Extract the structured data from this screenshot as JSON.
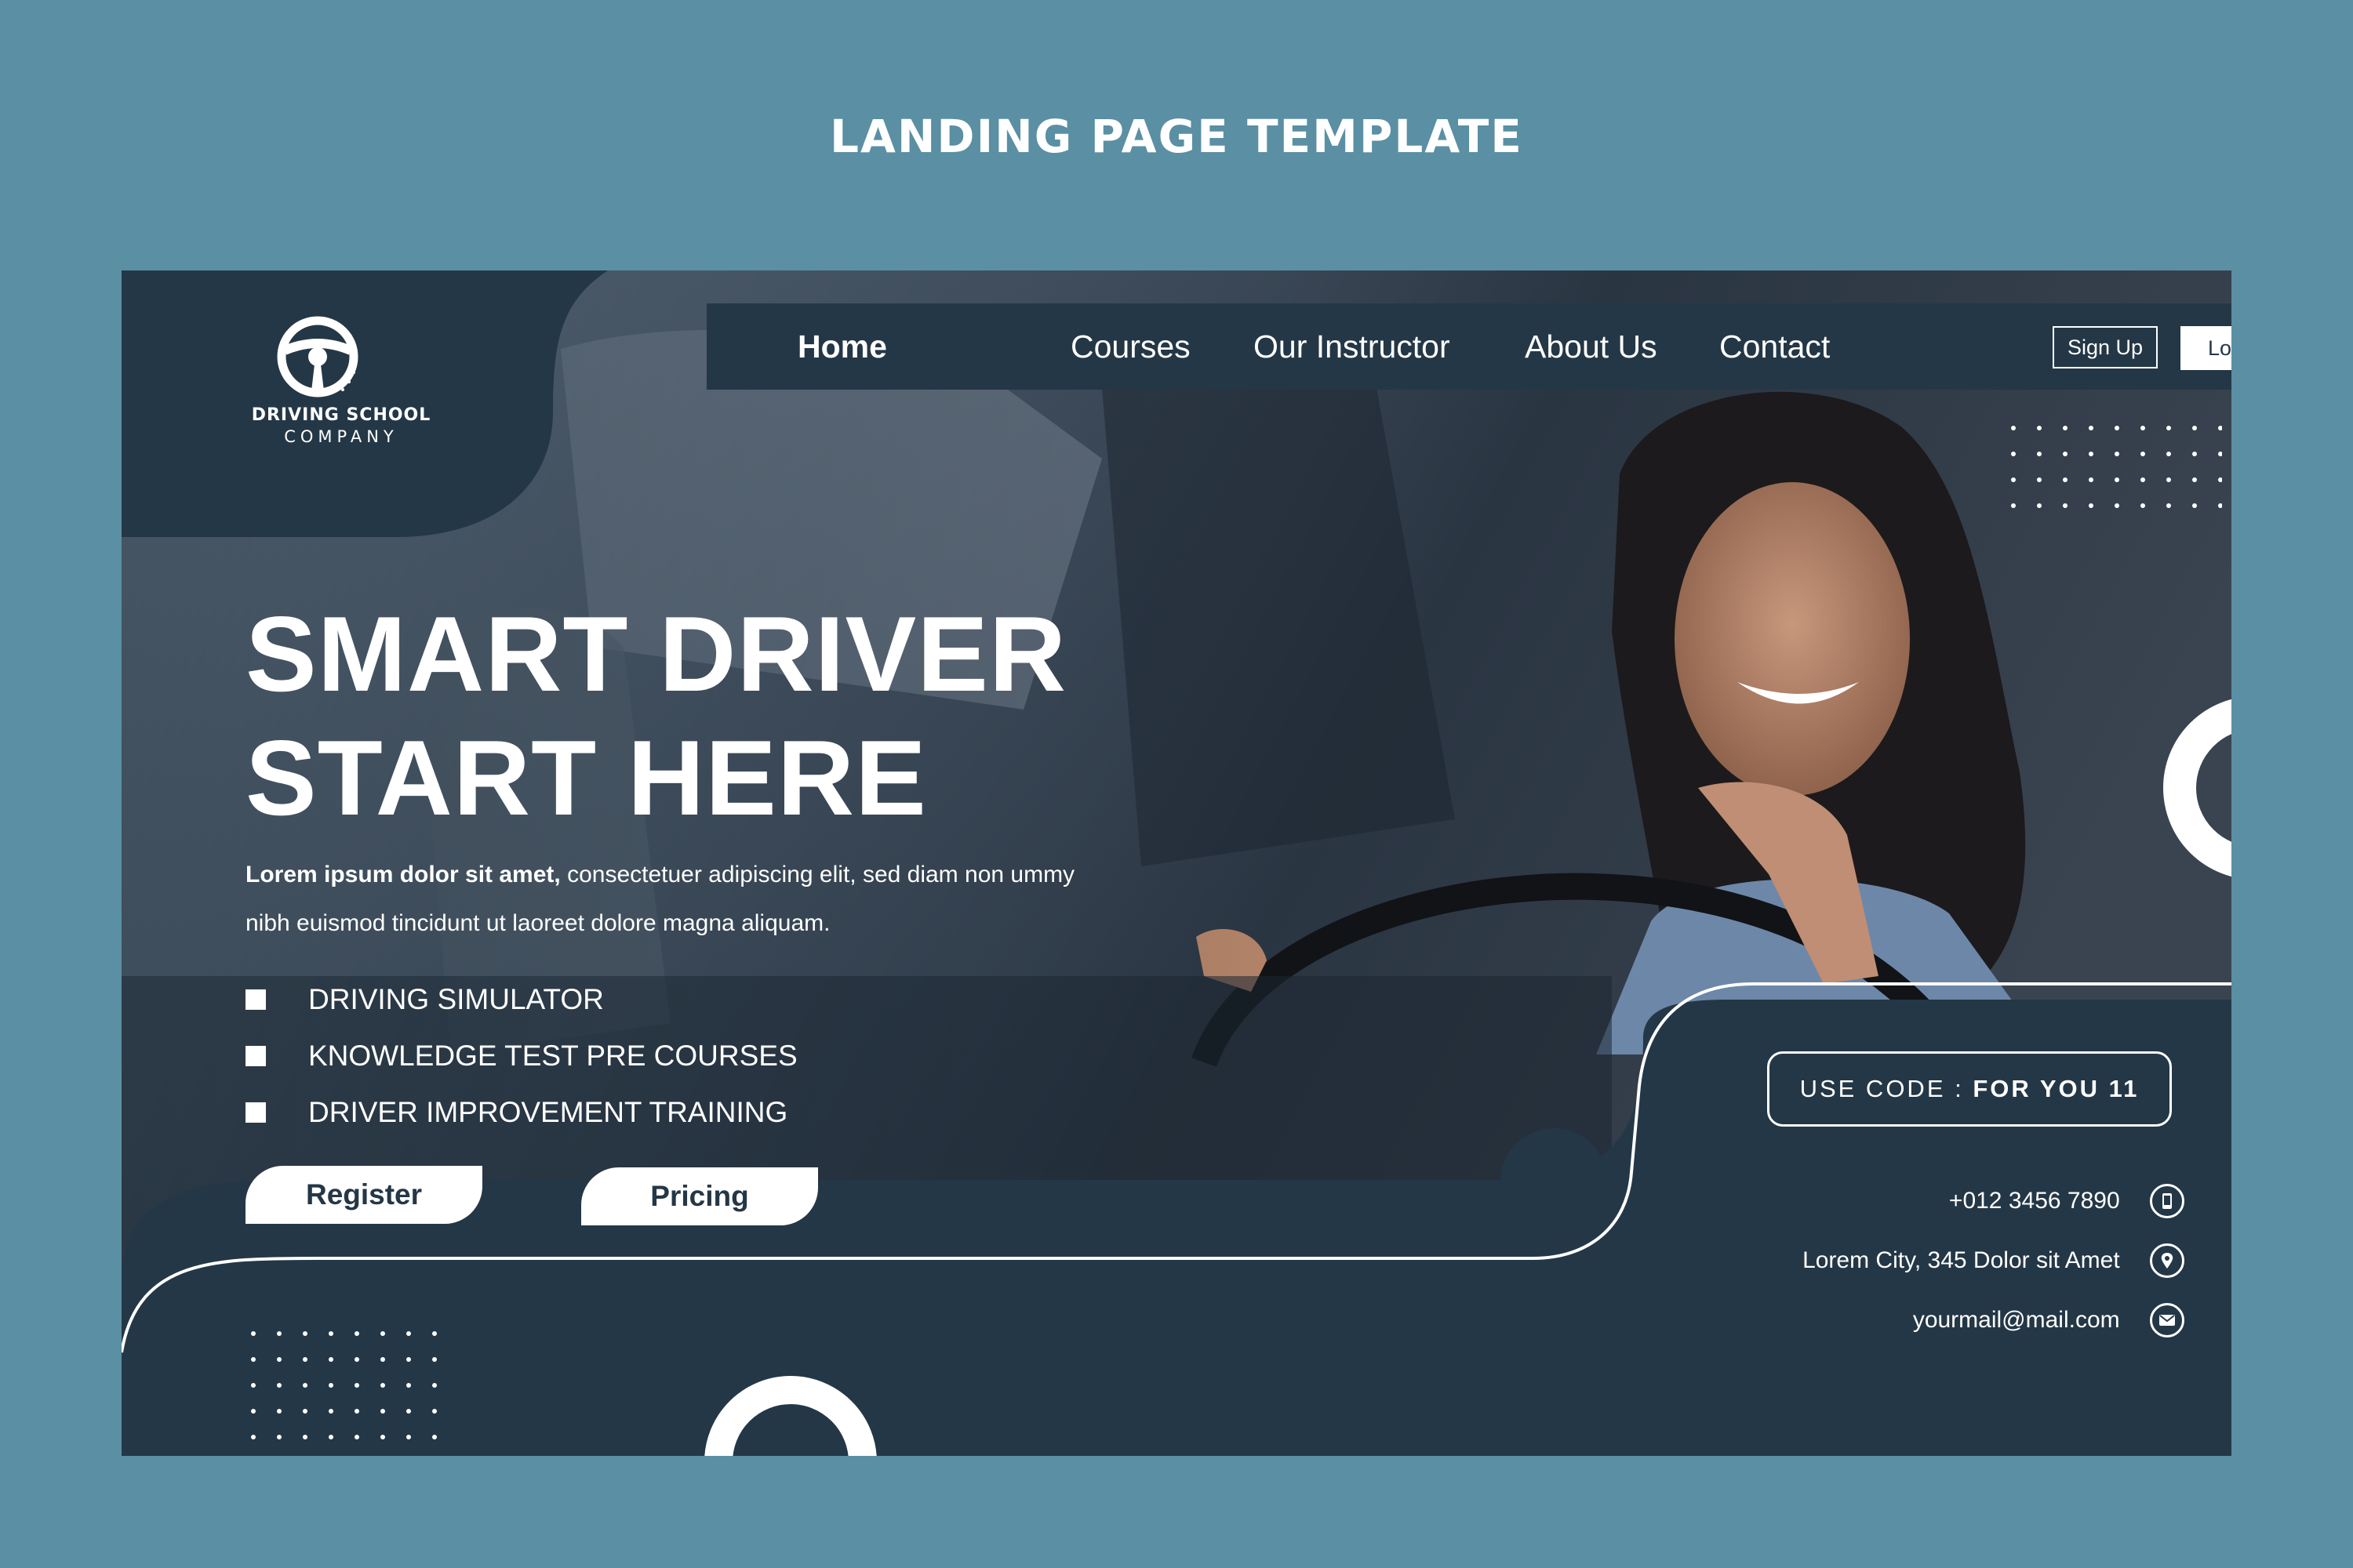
{
  "page_heading": "LANDING PAGE TEMPLATE",
  "logo": {
    "icon": "steering-wheel-icon",
    "title": "DRIVING SCHOOL",
    "subtitle": "COMPANY"
  },
  "nav": {
    "items": [
      {
        "label": "Home",
        "active": true
      },
      {
        "label": "Courses",
        "active": false
      },
      {
        "label": "Our Instructor",
        "active": false
      },
      {
        "label": "About Us",
        "active": false
      },
      {
        "label": "Contact",
        "active": false
      }
    ],
    "signup_label": "Sign Up",
    "login_label": "Login"
  },
  "hero": {
    "headline_line1": "SMART DRIVER",
    "headline_line2": "START HERE",
    "intro_lead": "Lorem ipsum dolor sit amet,",
    "intro_rest": " consectetuer adipiscing elit, sed diam non ummy nibh euismod tincidunt ut laoreet dolore magna aliquam.",
    "features": [
      "DRIVING SIMULATOR",
      "KNOWLEDGE TEST PRE COURSES",
      "DRIVER IMPROVEMENT TRAINING"
    ],
    "register_label": "Register",
    "pricing_label": "Pricing"
  },
  "promo": {
    "prefix": "USE CODE : ",
    "code": "FOR YOU 11"
  },
  "contact": {
    "phone": "+012 3456 7890",
    "phone_icon": "phone-icon",
    "address": "Lorem City, 345 Dolor sit Amet",
    "address_icon": "map-pin-icon",
    "email": "yourmail@mail.com",
    "email_icon": "mail-icon"
  },
  "colors": {
    "background": "#5b8fa3",
    "panel": "#243746",
    "text": "#ffffff"
  }
}
